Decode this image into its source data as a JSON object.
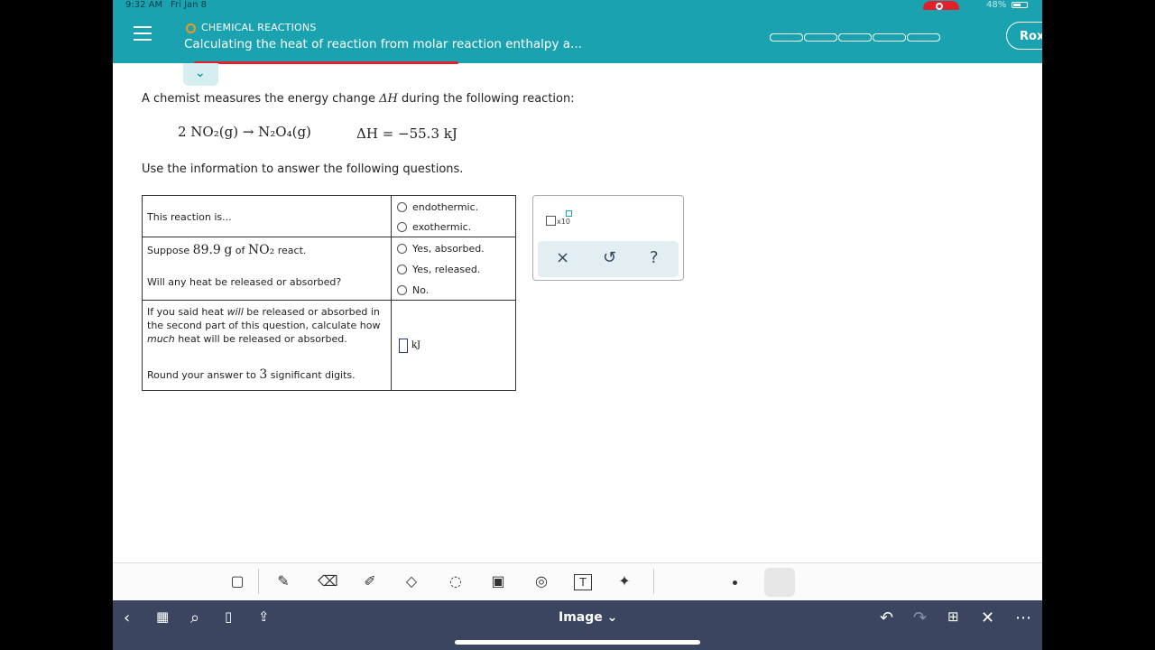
{
  "status": {
    "time": "9:32 AM",
    "date": "Fri Jan 8",
    "battery": "48%"
  },
  "header": {
    "topic": "CHEMICAL REACTIONS",
    "title": "Calculating the heat of reaction from molar reaction enthalpy a...",
    "progress_segments": 5,
    "user_initial": "Rox"
  },
  "content": {
    "intro_pre": "A chemist measures the energy change ",
    "intro_sym": "ΔH",
    "intro_post": " during the following reaction:",
    "equation": "2 NO₂(g) → N₂O₄(g)",
    "enthalpy": "ΔH = −55.3 kJ",
    "instructions": "Use the information to answer the following questions."
  },
  "table": {
    "row1_q": "This reaction is...",
    "row1_opts": [
      "endothermic.",
      "exothermic."
    ],
    "row2_q_a": "Suppose",
    "row2_mass": "89.9",
    "row2_unit": "g",
    "row2_of": "of",
    "row2_species": "NO₂",
    "row2_react": "react.",
    "row2_q2": "Will any heat be released or absorbed?",
    "row2_opts": [
      "Yes, absorbed.",
      "Yes, released.",
      "No."
    ],
    "row3_l1_a": "If you said heat ",
    "row3_l1_em": "will",
    "row3_l1_b": " be released or absorbed in",
    "row3_l2": "the second part of this question, calculate how",
    "row3_l3_em": "much",
    "row3_l3_b": " heat will be released or absorbed.",
    "row3_round_a": "Round your answer to",
    "row3_round_num": "3",
    "row3_round_b": "significant digits.",
    "answer_unit": "kJ"
  },
  "tools": {
    "x10": "x10",
    "clear": "×",
    "undo": "↺",
    "help": "?"
  },
  "annotation": {
    "text_tool": "T"
  },
  "bottom": {
    "image_title": "Image ⌄"
  }
}
